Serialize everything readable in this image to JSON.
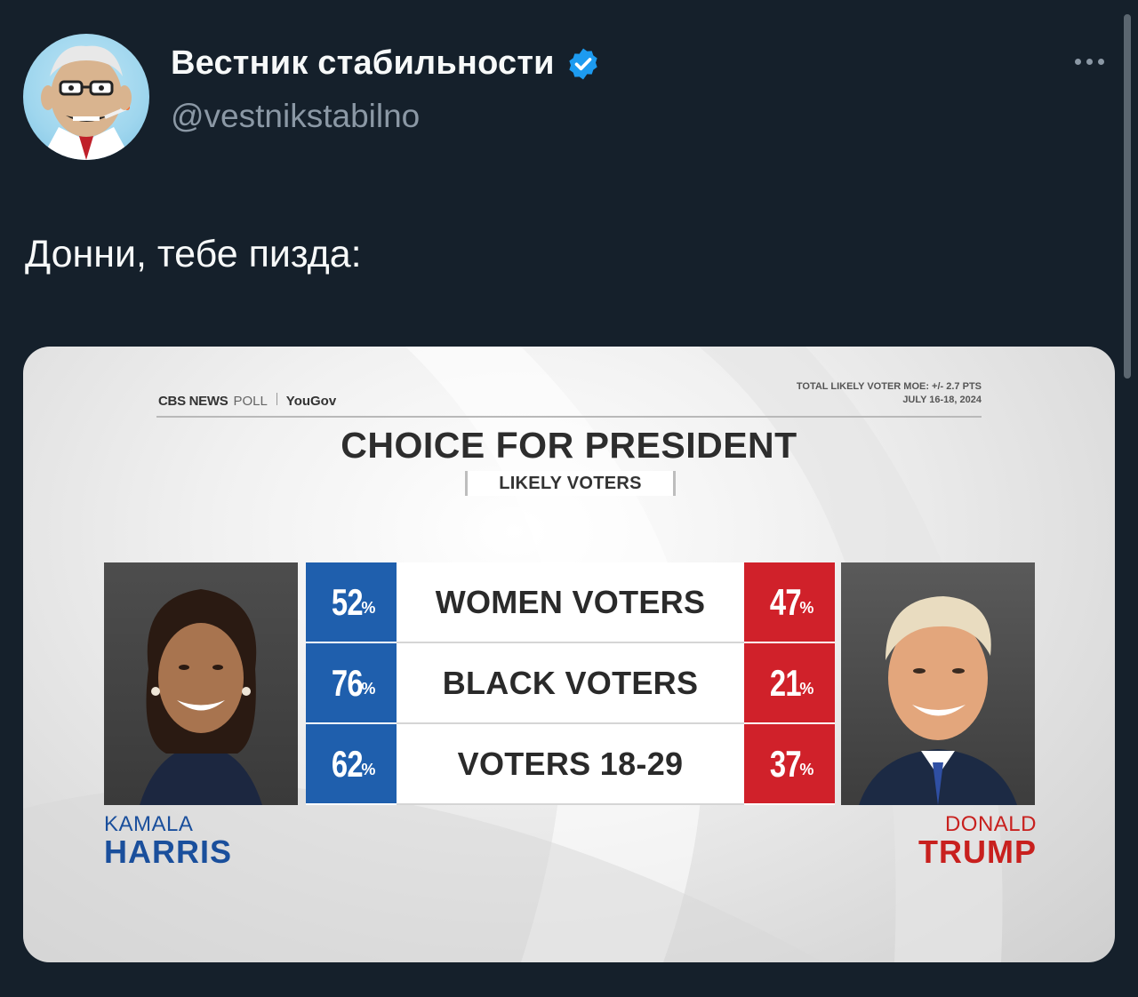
{
  "author": {
    "display_name": "Вестник стабильности",
    "handle": "@vestnikstabilno",
    "verified_icon": "verified-badge-icon",
    "avatar_icon": "cartoon-avatar-icon"
  },
  "tweet": {
    "text": "Донни, тебе пизда:"
  },
  "media": {
    "source": "CBS NEWS",
    "poll_word": "POLL",
    "partner": "YouGov",
    "moe_line1": "TOTAL LIKELY VOTER MOE: +/- 2.7 PTS",
    "moe_line2": "JULY 16-18, 2024",
    "headline": "CHOICE FOR PRESIDENT",
    "subhead": "LIKELY VOTERS",
    "left_candidate": {
      "first": "KAMALA",
      "last": "HARRIS"
    },
    "right_candidate": {
      "first": "DONALD",
      "last": "TRUMP"
    },
    "rows": [
      {
        "label": "WOMEN VOTERS",
        "left_value": "52",
        "right_value": "47"
      },
      {
        "label": "BLACK VOTERS",
        "left_value": "76",
        "right_value": "21"
      },
      {
        "label": "VOTERS 18-29",
        "left_value": "62",
        "right_value": "37"
      }
    ],
    "percent_sign": "%",
    "colors": {
      "left": "#1f5fad",
      "right": "#d0212a"
    }
  }
}
